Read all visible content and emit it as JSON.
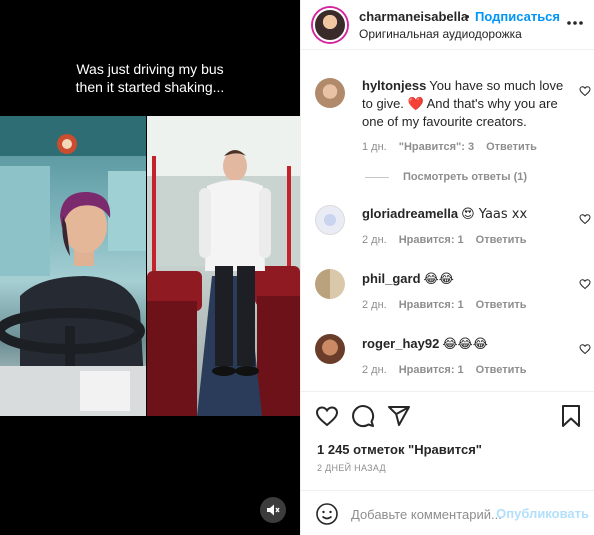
{
  "video": {
    "caption": "Was just driving my bus\nthen it started shaking...",
    "mute_icon": "speaker-muted-icon"
  },
  "header": {
    "username": "charmaneisabella",
    "separator": "•",
    "follow_label": "Подписаться",
    "audio_label": "Оригинальная аудиодорожка",
    "more_icon": "more-options-icon"
  },
  "comments": [
    {
      "username": "hyltonjess",
      "text": "You have so much love to give. ❤️ And that's why you are one of my favourite creators.",
      "time": "1 дн.",
      "likes": "\"Нравится\": 3",
      "reply_label": "Ответить",
      "view_replies_label": "Посмотреть ответы (1)"
    },
    {
      "username": "gloriadreamella",
      "text": "😍 Yaas xx",
      "time": "2 дн.",
      "likes": "Нравится: 1",
      "reply_label": "Ответить"
    },
    {
      "username": "phil_gard",
      "text": "😂😂",
      "time": "2 дн.",
      "likes": "Нравится: 1",
      "reply_label": "Ответить"
    },
    {
      "username": "roger_hay92",
      "text": "😂😂😂",
      "time": "2 дн.",
      "likes": "Нравится: 1",
      "reply_label": "Ответить"
    }
  ],
  "actions": {
    "icons": [
      "heart-icon",
      "comment-icon",
      "share-icon",
      "bookmark-icon"
    ]
  },
  "likes_count": "1 245 отметок \"Нравится\"",
  "post_date": "2 ДНЕЙ НАЗАД",
  "add_comment": {
    "placeholder": "Добавьте комментарий...",
    "post_label": "Опубликовать"
  },
  "colors": {
    "accent": "#0095f6",
    "post_disabled": "#b2dffc",
    "muted_text": "#8e8e8e",
    "heart_red": "#ed4956"
  }
}
